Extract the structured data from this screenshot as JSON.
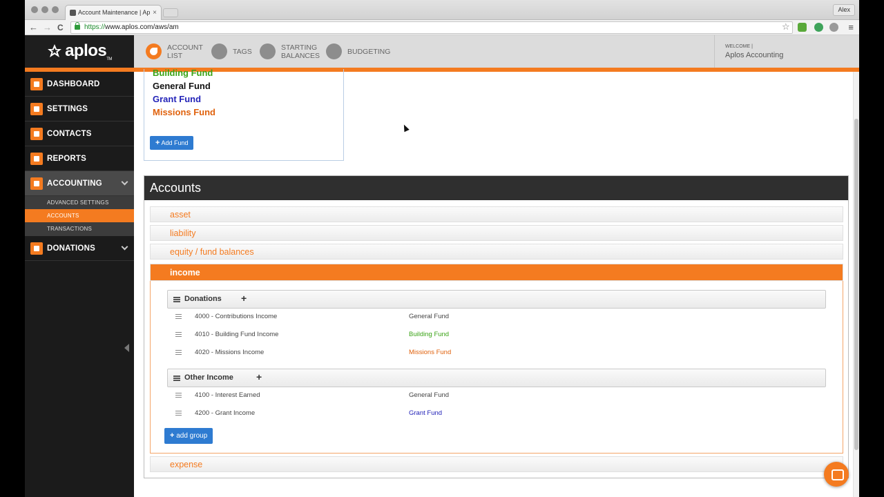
{
  "browser": {
    "tab_title": "Account Maintenance | Ap",
    "tab_close": "×",
    "url_scheme": "https://",
    "url_rest": "www.aplos.com/aws/am",
    "user": "Alex",
    "back": "←",
    "forward": "→",
    "reload": "C",
    "star": "☆",
    "menu": "≡"
  },
  "header": {
    "logo": "aplos",
    "logo_tm": "TM",
    "nav": [
      {
        "line1": "ACCOUNT",
        "line2": "LIST"
      },
      {
        "line1": "TAGS",
        "line2": ""
      },
      {
        "line1": "STARTING",
        "line2": "BALANCES"
      },
      {
        "line1": "BUDGETING",
        "line2": ""
      }
    ],
    "welcome_label": "WELCOME |",
    "welcome_name": "Aplos Accounting"
  },
  "sidebar": {
    "items": [
      {
        "label": "DASHBOARD"
      },
      {
        "label": "SETTINGS"
      },
      {
        "label": "CONTACTS"
      },
      {
        "label": "REPORTS"
      },
      {
        "label": "ACCOUNTING"
      },
      {
        "label": "DONATIONS"
      }
    ],
    "submenu": [
      {
        "label": "ADVANCED SETTINGS"
      },
      {
        "label": "ACCOUNTS"
      },
      {
        "label": "TRANSACTIONS"
      }
    ]
  },
  "funds": {
    "items": [
      {
        "label": "Building Fund",
        "color": "#3aa316"
      },
      {
        "label": "General Fund",
        "color": "#111111"
      },
      {
        "label": "Grant Fund",
        "color": "#2323b8"
      },
      {
        "label": "Missions Fund",
        "color": "#e0620d"
      }
    ],
    "add_button": "Add Fund"
  },
  "accounts": {
    "title": "Accounts",
    "categories": [
      "asset",
      "liability",
      "equity / fund balances",
      "income",
      "expense"
    ],
    "groups": [
      {
        "name": "Donations",
        "accounts": [
          {
            "name": "4000 - Contributions Income",
            "fund": "General Fund",
            "color": "#444444"
          },
          {
            "name": "4010 - Building Fund Income",
            "fund": "Building Fund",
            "color": "#3aa316"
          },
          {
            "name": "4020 - Missions Income",
            "fund": "Missions Fund",
            "color": "#e0620d"
          }
        ]
      },
      {
        "name": "Other Income",
        "accounts": [
          {
            "name": "4100 - Interest Earned",
            "fund": "General Fund",
            "color": "#444444"
          },
          {
            "name": "4200 - Grant Income",
            "fund": "Grant Fund",
            "color": "#2323b8"
          }
        ]
      }
    ],
    "add_group": "add group",
    "plus": "+"
  },
  "colors": {
    "accent": "#f47b20",
    "button_blue": "#2e7bd1",
    "sidebar_bg": "#1b1b1b"
  }
}
